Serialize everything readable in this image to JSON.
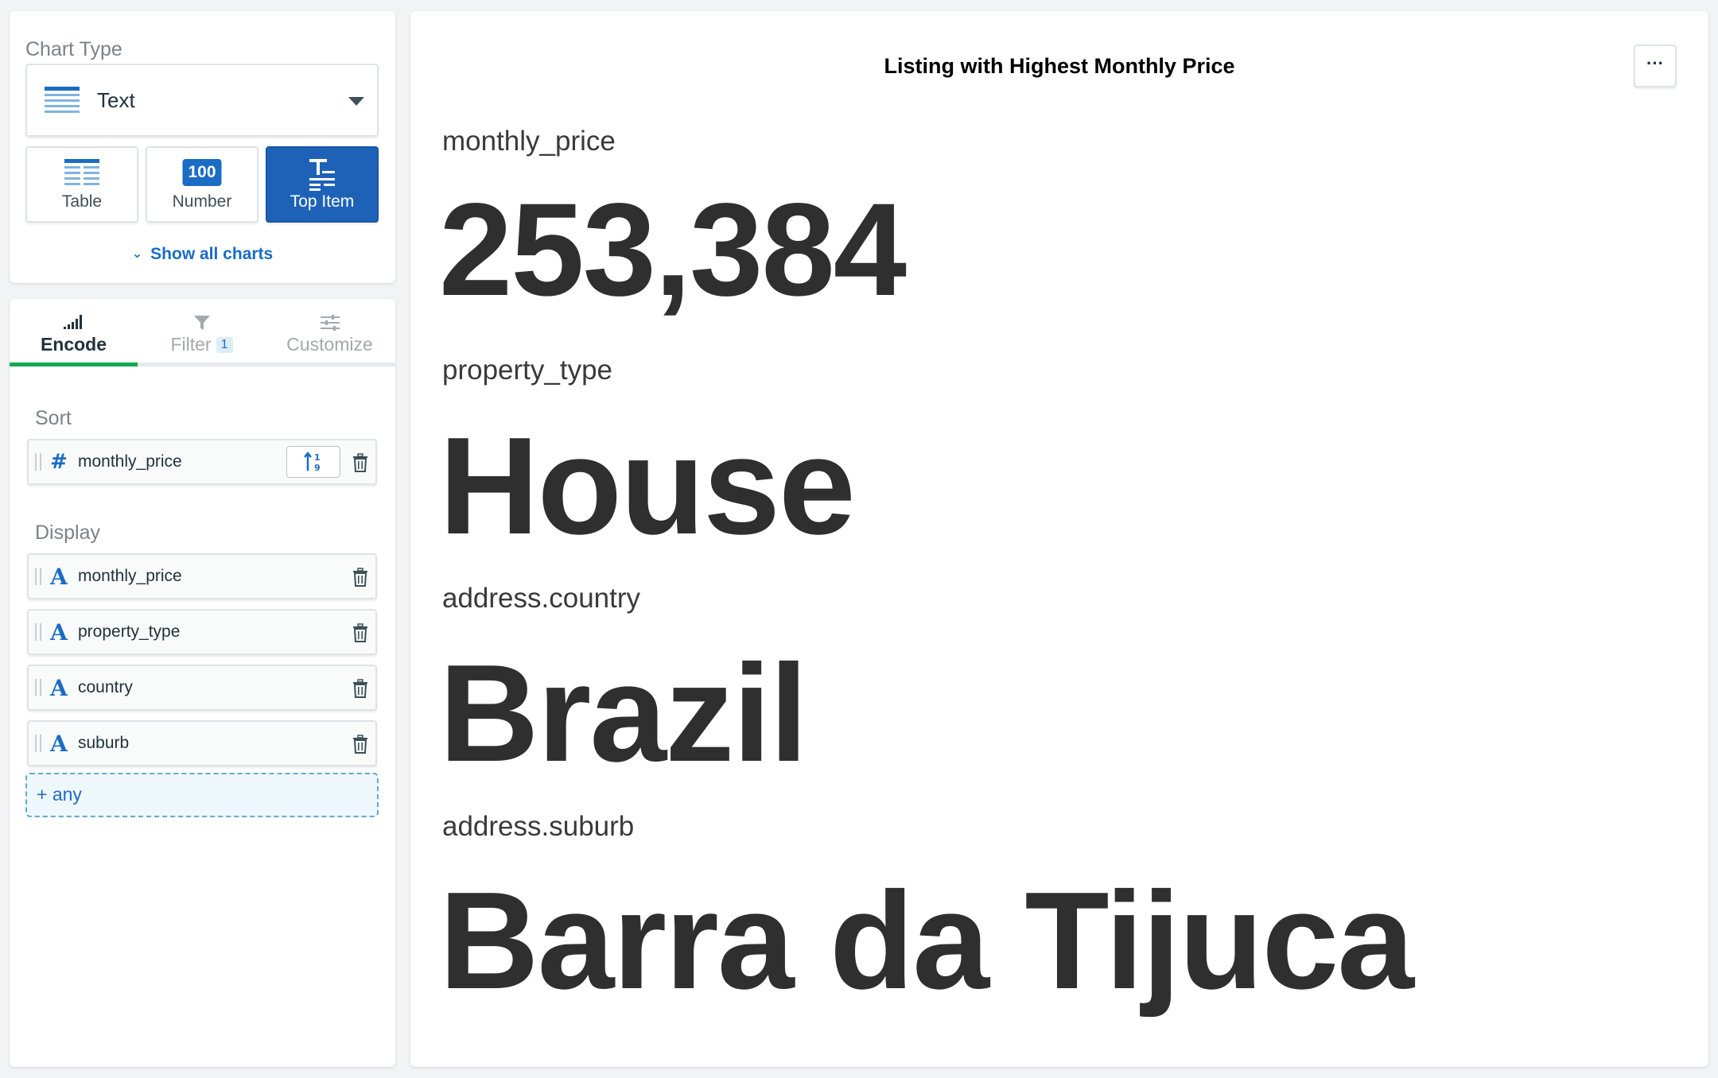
{
  "chart_type_panel": {
    "title": "Chart Type",
    "selected_type": "Text",
    "options": [
      {
        "label": "Table",
        "selected": false
      },
      {
        "label": "Number",
        "badge": "100",
        "selected": false
      },
      {
        "label": "Top Item",
        "selected": true
      }
    ],
    "show_all_label": "Show all charts"
  },
  "tabs": [
    {
      "label": "Encode",
      "active": true
    },
    {
      "label": "Filter",
      "badge": "1",
      "active": false
    },
    {
      "label": "Customize",
      "active": false
    }
  ],
  "encode": {
    "sort_title": "Sort",
    "sort_field": {
      "name": "monthly_price",
      "type_icon": "#",
      "icon": "hash-icon"
    },
    "display_title": "Display",
    "display_fields": [
      {
        "name": "monthly_price",
        "type_icon": "A",
        "icon": "string-type-icon"
      },
      {
        "name": "property_type",
        "type_icon": "A",
        "icon": "string-type-icon"
      },
      {
        "name": "country",
        "type_icon": "A",
        "icon": "string-type-icon"
      },
      {
        "name": "suburb",
        "type_icon": "A",
        "icon": "string-type-icon"
      }
    ],
    "add_any_label": "+ any"
  },
  "chart": {
    "title": "Listing with Highest Monthly Price",
    "more_label": "···",
    "items": [
      {
        "label": "monthly_price",
        "value": "253,384"
      },
      {
        "label": "property_type",
        "value": "House"
      },
      {
        "label": "address.country",
        "value": "Brazil"
      },
      {
        "label": "address.suburb",
        "value": "Barra da Tijuca"
      }
    ]
  },
  "colors": {
    "accent_blue": "#1a6cc4",
    "active_button": "#1e62b8",
    "active_tab_underline": "#13aa52",
    "value_text": "#2f2f2f"
  }
}
